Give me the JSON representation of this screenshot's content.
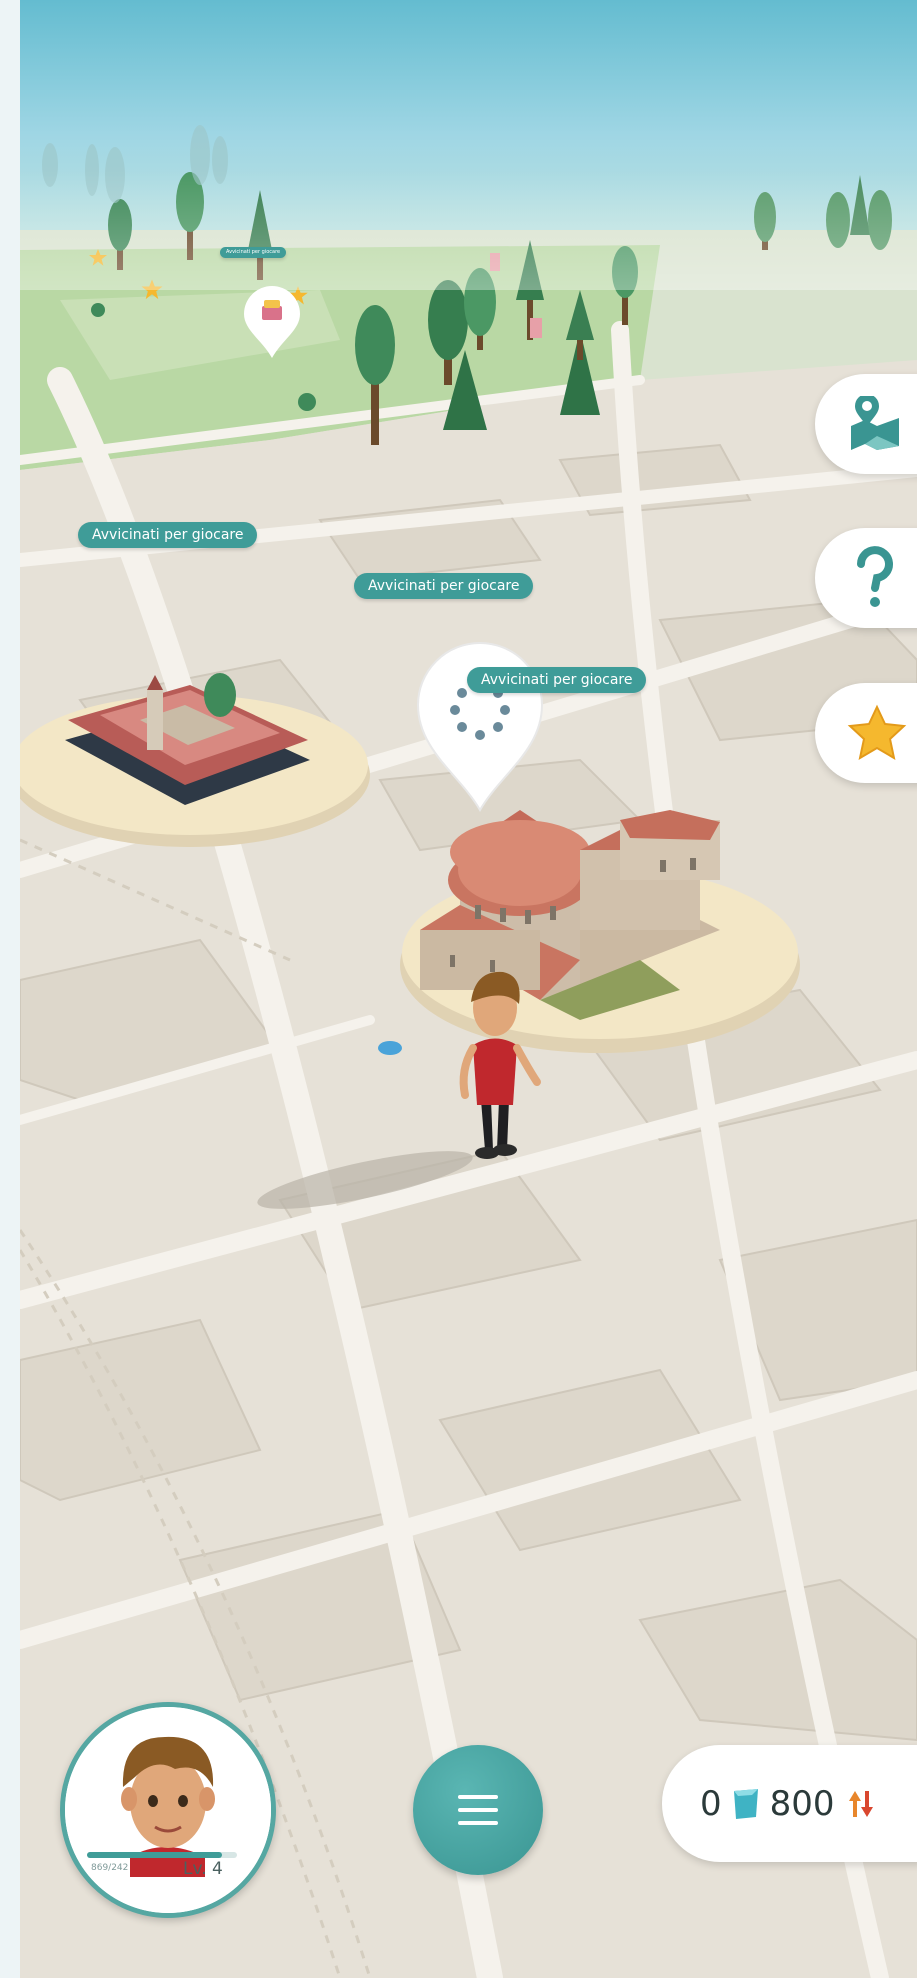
{
  "map": {
    "approach_labels": [
      "Avvicinati per giocare",
      "Avvicinati per giocare",
      "Avvicinati per giocare"
    ],
    "approach_label_small": "Avvicinati per giocare"
  },
  "side_buttons": [
    {
      "name": "map-button",
      "icon": "map-pin-icon"
    },
    {
      "name": "help-button",
      "icon": "question-mark-icon"
    },
    {
      "name": "favorites-button",
      "icon": "star-icon"
    }
  ],
  "player": {
    "xp_text": "869/242",
    "xp_progress": 0.9,
    "level": "Lv. 4"
  },
  "resources": {
    "gems": "0",
    "coins": "800"
  },
  "colors": {
    "accent": "#3f9c98",
    "map_bg": "#e6e1d7",
    "sky": "#9fd6e4",
    "grass": "#b9d8a4",
    "star": "#f5b82e"
  }
}
